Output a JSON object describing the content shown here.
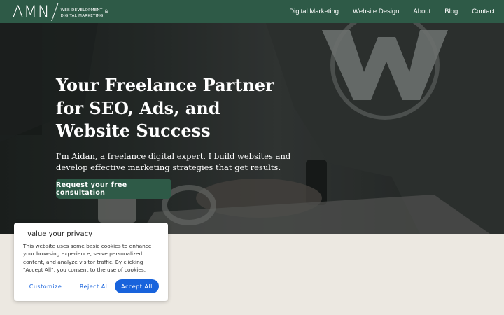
{
  "header": {
    "logo_text": "AMN",
    "logo_tagline_line1": "WEB DEVELOPMENT",
    "logo_tagline_line2": "DIGITAL MARKETING",
    "logo_amp": "&",
    "nav": [
      {
        "label": "Digital Marketing"
      },
      {
        "label": "Website Design"
      },
      {
        "label": "About"
      },
      {
        "label": "Blog"
      },
      {
        "label": "Contact"
      }
    ]
  },
  "hero": {
    "title_line1": "Your Freelance Partner",
    "title_line2": "for SEO, Ads, and",
    "title_line3": "Website Success",
    "subtitle": "I'm Aidan, a freelance digital expert. I build websites and develop effective marketing strategies that get results.",
    "cta_label": "Request your free consultation"
  },
  "cookie_banner": {
    "title": "I value your privacy",
    "text": "This website uses some basic cookies to enhance your browsing experience, serve personalized content, and analyze visitor traffic. By clicking \"Accept All\", you consent to the use of cookies.",
    "customize_label": "Customize",
    "reject_label": "Reject All",
    "accept_label": "Accept All"
  },
  "colors": {
    "brand_green": "#2e5a47",
    "accept_blue": "#1863dc",
    "section_bg": "#ece8e1"
  }
}
